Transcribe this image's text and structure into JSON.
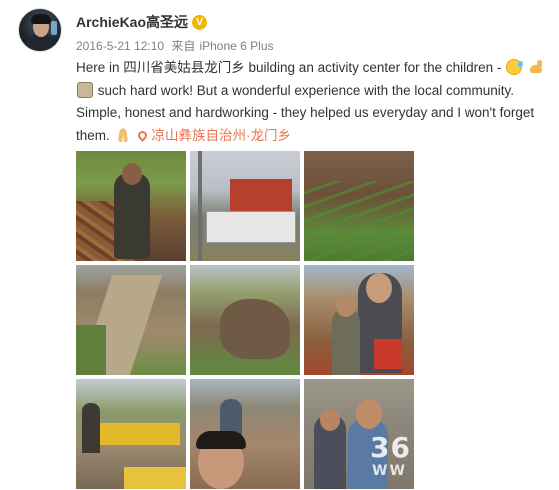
{
  "user": {
    "name": "ArchieKao高圣远",
    "verified_badge": "V"
  },
  "meta": {
    "timestamp": "2016-5-21 12:10",
    "via_label": "来自",
    "device": "iPhone 6 Plus"
  },
  "post": {
    "line1": "Here in 四川省美姑县龙门乡 building an activity center for the children -",
    "line2": "such hard work! But a wonderful experience with the local community.",
    "line3": "Simple, honest and hardworking - they helped us everyday and I won't forget",
    "line4": "them.",
    "location": "凉山彝族自治州·龙门乡"
  },
  "emojis": [
    "sweat-smile",
    "flexed-biceps",
    "box",
    "folded-hands"
  ],
  "photos": [
    {
      "id": "p1",
      "subject": "boy-with-logs"
    },
    {
      "id": "p2",
      "subject": "truck-and-pickup"
    },
    {
      "id": "p3",
      "subject": "field"
    },
    {
      "id": "p4",
      "subject": "dirt-road"
    },
    {
      "id": "p5",
      "subject": "excavated-ground"
    },
    {
      "id": "p6",
      "subject": "kids-with-man"
    },
    {
      "id": "p7",
      "subject": "yellow-containers"
    },
    {
      "id": "p8",
      "subject": "smiling-man"
    },
    {
      "id": "p9",
      "subject": "two-kids"
    }
  ],
  "watermark": {
    "big": "36",
    "small": "WW"
  },
  "colors": {
    "link": "#eb7350",
    "meta": "#808080",
    "text": "#333333",
    "badge": "#f5b600"
  }
}
